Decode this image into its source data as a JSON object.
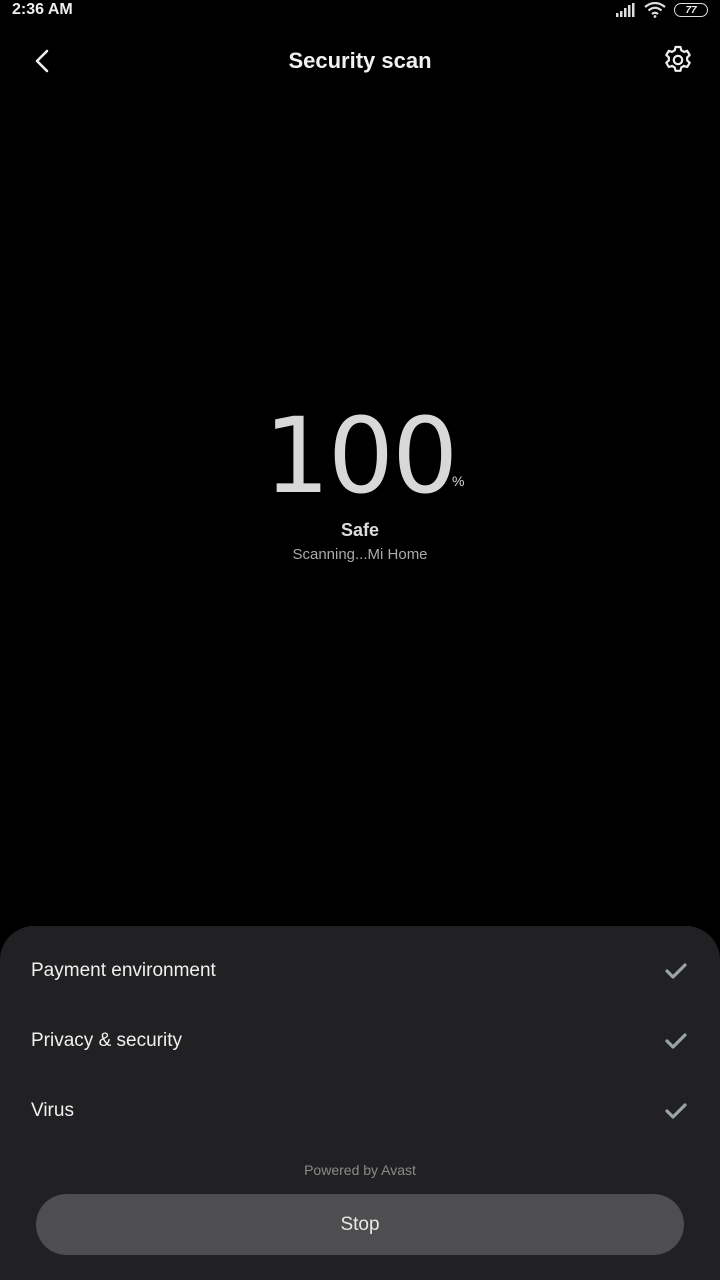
{
  "status_bar": {
    "time": "2:36 AM",
    "battery": "77"
  },
  "header": {
    "title": "Security scan"
  },
  "scan": {
    "score": "100",
    "unit": "%",
    "status": "Safe",
    "progress_text": "Scanning...Mi Home"
  },
  "checks": [
    {
      "label": "Payment environment",
      "state": "done"
    },
    {
      "label": "Privacy & security",
      "state": "done"
    },
    {
      "label": "Virus",
      "state": "done"
    }
  ],
  "footer": {
    "powered_by": "Powered by Avast",
    "stop_label": "Stop"
  },
  "colors": {
    "background": "#000000",
    "sheet": "#212123",
    "button": "#4e4e50",
    "check": "#9aa3a8"
  }
}
